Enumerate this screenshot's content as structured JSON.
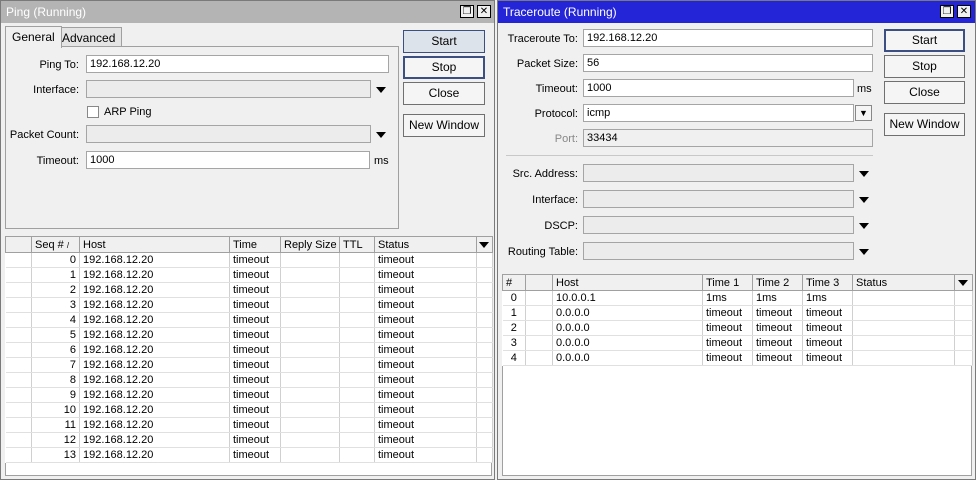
{
  "ping": {
    "title": "Ping (Running)",
    "tabs": [
      "General",
      "Advanced"
    ],
    "ping_to_label": "Ping To:",
    "ping_to_value": "192.168.12.20",
    "interface_label": "Interface:",
    "arp_ping_label": "ARP Ping",
    "packet_count_label": "Packet Count:",
    "timeout_label": "Timeout:",
    "timeout_value": "1000",
    "timeout_unit": "ms",
    "buttons": {
      "start": "Start",
      "stop": "Stop",
      "close": "Close",
      "new_window": "New Window"
    },
    "columns": [
      "Seq #",
      "Host",
      "Time",
      "Reply Size",
      "TTL",
      "Status"
    ],
    "rows": [
      {
        "seq": "0",
        "host": "192.168.12.20",
        "time": "timeout",
        "reply": "",
        "ttl": "",
        "status": "timeout"
      },
      {
        "seq": "1",
        "host": "192.168.12.20",
        "time": "timeout",
        "reply": "",
        "ttl": "",
        "status": "timeout"
      },
      {
        "seq": "2",
        "host": "192.168.12.20",
        "time": "timeout",
        "reply": "",
        "ttl": "",
        "status": "timeout"
      },
      {
        "seq": "3",
        "host": "192.168.12.20",
        "time": "timeout",
        "reply": "",
        "ttl": "",
        "status": "timeout"
      },
      {
        "seq": "4",
        "host": "192.168.12.20",
        "time": "timeout",
        "reply": "",
        "ttl": "",
        "status": "timeout"
      },
      {
        "seq": "5",
        "host": "192.168.12.20",
        "time": "timeout",
        "reply": "",
        "ttl": "",
        "status": "timeout"
      },
      {
        "seq": "6",
        "host": "192.168.12.20",
        "time": "timeout",
        "reply": "",
        "ttl": "",
        "status": "timeout"
      },
      {
        "seq": "7",
        "host": "192.168.12.20",
        "time": "timeout",
        "reply": "",
        "ttl": "",
        "status": "timeout"
      },
      {
        "seq": "8",
        "host": "192.168.12.20",
        "time": "timeout",
        "reply": "",
        "ttl": "",
        "status": "timeout"
      },
      {
        "seq": "9",
        "host": "192.168.12.20",
        "time": "timeout",
        "reply": "",
        "ttl": "",
        "status": "timeout"
      },
      {
        "seq": "10",
        "host": "192.168.12.20",
        "time": "timeout",
        "reply": "",
        "ttl": "",
        "status": "timeout"
      },
      {
        "seq": "11",
        "host": "192.168.12.20",
        "time": "timeout",
        "reply": "",
        "ttl": "",
        "status": "timeout"
      },
      {
        "seq": "12",
        "host": "192.168.12.20",
        "time": "timeout",
        "reply": "",
        "ttl": "",
        "status": "timeout"
      },
      {
        "seq": "13",
        "host": "192.168.12.20",
        "time": "timeout",
        "reply": "",
        "ttl": "",
        "status": "timeout"
      }
    ]
  },
  "traceroute": {
    "title": "Traceroute (Running)",
    "traceroute_to_label": "Traceroute To:",
    "traceroute_to_value": "192.168.12.20",
    "packet_size_label": "Packet Size:",
    "packet_size_value": "56",
    "timeout_label": "Timeout:",
    "timeout_value": "1000",
    "timeout_unit": "ms",
    "protocol_label": "Protocol:",
    "protocol_value": "icmp",
    "port_label": "Port:",
    "port_value": "33434",
    "src_address_label": "Src. Address:",
    "interface_label": "Interface:",
    "dscp_label": "DSCP:",
    "routing_table_label": "Routing Table:",
    "buttons": {
      "start": "Start",
      "stop": "Stop",
      "close": "Close",
      "new_window": "New Window"
    },
    "columns": [
      "#",
      "Host",
      "Time 1",
      "Time 2",
      "Time 3",
      "Status"
    ],
    "rows": [
      {
        "n": "0",
        "host": "10.0.0.1",
        "t1": "1ms",
        "t2": "1ms",
        "t3": "1ms",
        "status": ""
      },
      {
        "n": "1",
        "host": "0.0.0.0",
        "t1": "timeout",
        "t2": "timeout",
        "t3": "timeout",
        "status": ""
      },
      {
        "n": "2",
        "host": "0.0.0.0",
        "t1": "timeout",
        "t2": "timeout",
        "t3": "timeout",
        "status": ""
      },
      {
        "n": "3",
        "host": "0.0.0.0",
        "t1": "timeout",
        "t2": "timeout",
        "t3": "timeout",
        "status": ""
      },
      {
        "n": "4",
        "host": "0.0.0.0",
        "t1": "timeout",
        "t2": "timeout",
        "t3": "timeout",
        "status": ""
      }
    ]
  },
  "colors": {
    "active_title": "#2525d8",
    "inactive_title": "#b4b4b4"
  }
}
